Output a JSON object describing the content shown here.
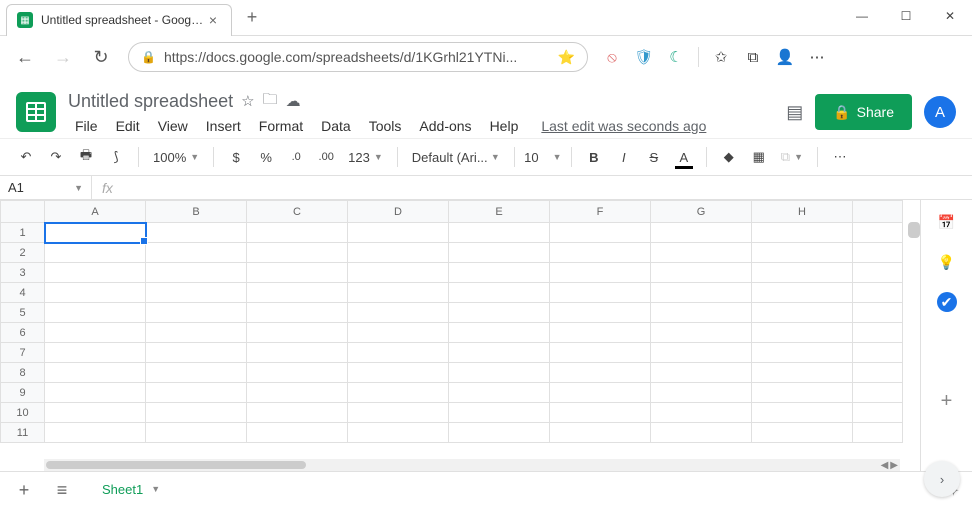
{
  "browser": {
    "tab_title": "Untitled spreadsheet - Google Sh",
    "url": "https://docs.google.com/spreadsheets/d/1KGrhl21YTNi...",
    "new_tab": "+",
    "close_tab": "×",
    "win_min": "—",
    "win_max": "☐",
    "win_close": "✕",
    "back": "←",
    "forward": "→",
    "reload": "↻",
    "lock": "🔒",
    "fav": "⭐",
    "ext1": "⦸",
    "ext2": "🛡",
    "ext3": "☾",
    "collections": "⧉",
    "menu": "⋯",
    "profile": "👤",
    "addfav": "✩"
  },
  "doc": {
    "title": "Untitled spreadsheet",
    "star": "☆",
    "move": "🗀",
    "cloud": "☁",
    "menus": [
      "File",
      "Edit",
      "View",
      "Insert",
      "Format",
      "Data",
      "Tools",
      "Add-ons",
      "Help"
    ],
    "last_edit": "Last edit was seconds ago",
    "comments": "▤",
    "share_label": "Share",
    "share_icon": "🔒",
    "avatar_initial": "A"
  },
  "toolbar": {
    "undo": "↶",
    "redo": "↷",
    "print": "🖶",
    "paint": "⟆",
    "zoom": "100%",
    "currency": "$",
    "percent": "%",
    "dec_less": ".0",
    "dec_more": ".00",
    "more_formats": "123",
    "font": "Default (Ari...",
    "font_size": "10",
    "bold": "B",
    "italic": "I",
    "strike": "S",
    "text_color": "A",
    "fill": "◆",
    "borders": "▦",
    "merge": "⧉",
    "more": "⋯"
  },
  "formula_bar": {
    "cell_ref": "A1",
    "fx": "fx",
    "value": ""
  },
  "grid": {
    "columns": [
      "A",
      "B",
      "C",
      "D",
      "E",
      "F",
      "G",
      "H"
    ],
    "rows": [
      "1",
      "2",
      "3",
      "4",
      "5",
      "6",
      "7",
      "8",
      "9",
      "10",
      "11"
    ],
    "selected": "A1"
  },
  "sidepanel": {
    "calendar": "📅",
    "keep": "💡",
    "tasks": "✔",
    "add": "+"
  },
  "bottombar": {
    "add": "+",
    "all": "≡",
    "sheet": "Sheet1",
    "explore": "✦",
    "fab": "›"
  }
}
